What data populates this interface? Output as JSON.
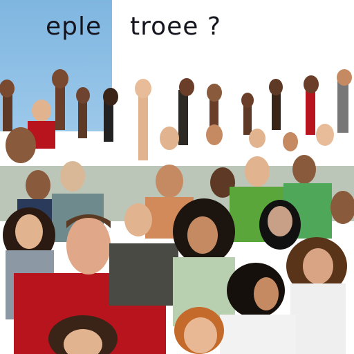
{
  "caption": {
    "left_text": "eple",
    "right_text": "troee ?"
  },
  "colors": {
    "sky_blue": "#8cc0e6",
    "shirt_red": "#b8141e",
    "shirt_green": "#5aa63a",
    "skin_tones": [
      "#e2b38f",
      "#c68a62",
      "#8a5a3c",
      "#5e3a26",
      "#f0c8a4"
    ]
  },
  "scene": {
    "subject": "crowd-of-people",
    "hands_raised": true
  }
}
